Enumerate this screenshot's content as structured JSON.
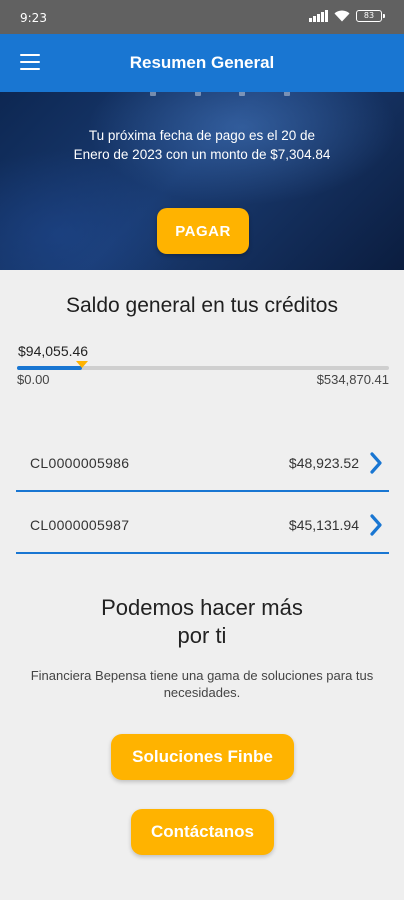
{
  "status_bar": {
    "time": "9:23",
    "battery": "83",
    "icons": [
      "signal-icon",
      "wifi-icon",
      "battery-icon"
    ]
  },
  "app_bar": {
    "title": "Resumen General",
    "menu_icon": "menu-icon"
  },
  "hero": {
    "message": "Tu próxima fecha de pago es el 20 de Enero de 2023 con un monto de $7,304.84",
    "pay_button": "PAGAR"
  },
  "balance": {
    "title": "Saldo general en tus créditos",
    "current": "$94,055.46",
    "min": "$0.00",
    "max": "$534,870.41",
    "progress_fraction": 0.176
  },
  "credits": [
    {
      "id": "CL0000005986",
      "amount": "$48,923.52"
    },
    {
      "id": "CL0000005987",
      "amount": "$45,131.94"
    }
  ],
  "promo": {
    "title_line1": "Podemos hacer más",
    "title_line2": "por ti",
    "text": "Financiera Bepensa tiene una gama de soluciones para tus necesidades.",
    "solutions_button": "Soluciones Finbe",
    "contact_button": "Contáctanos"
  },
  "colors": {
    "primary": "#1976d2",
    "accent": "#ffb300",
    "status_bar": "#616161",
    "background": "#efefef"
  }
}
